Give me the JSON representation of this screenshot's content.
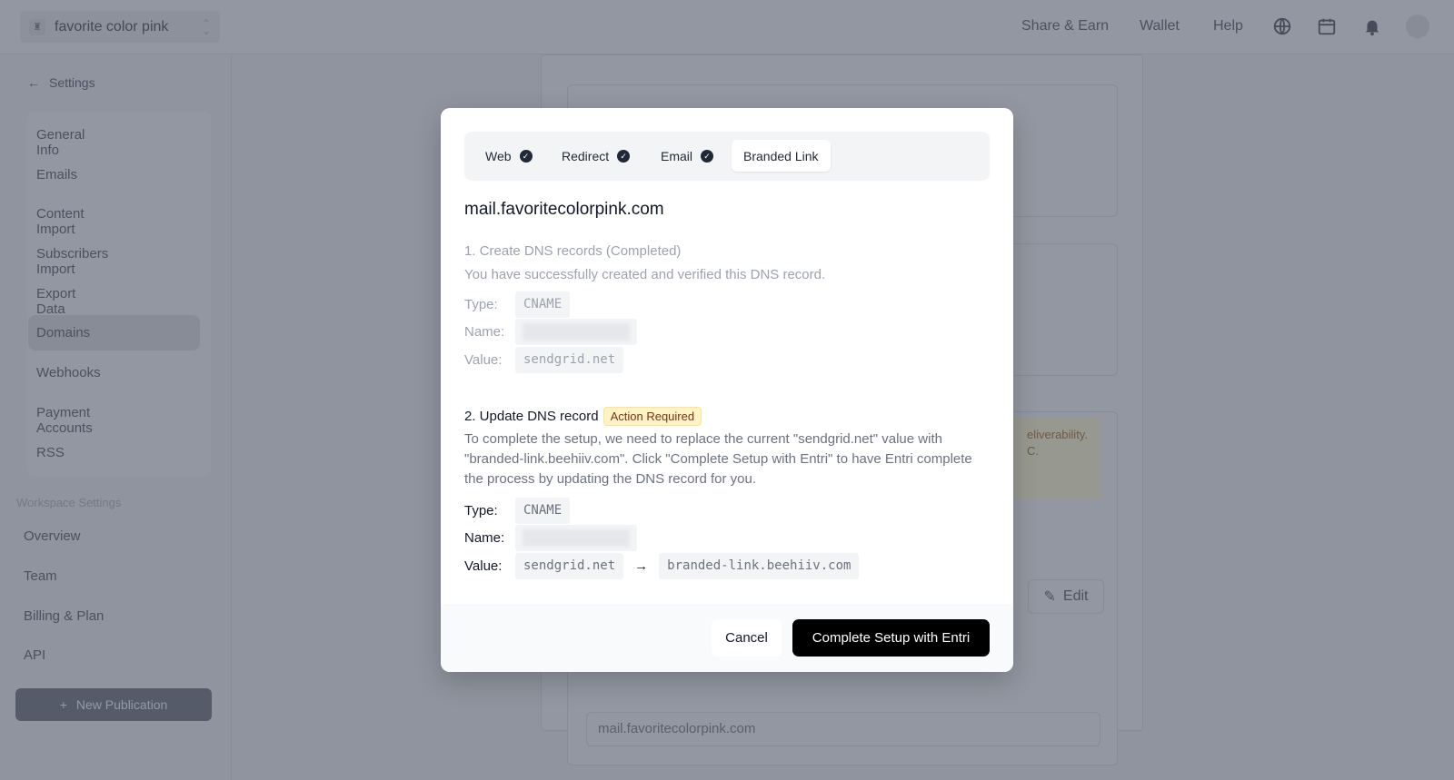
{
  "topbar": {
    "publication": "favorite color pink",
    "links": [
      "Share & Earn",
      "Wallet",
      "Help"
    ]
  },
  "sidebar": {
    "back": "Settings",
    "items": [
      "General Info",
      "Emails",
      "Content Import",
      "Subscribers Import",
      "Export Data",
      "Domains",
      "Webhooks",
      "Payment Accounts",
      "RSS"
    ],
    "active": "Domains",
    "workspace_label": "Workspace Settings",
    "workspace_items": [
      "Overview",
      "Team",
      "Billing & Plan",
      "API"
    ],
    "new_publication": "New Publication"
  },
  "background": {
    "warning_text_1": "eliverability.",
    "warning_text_2": "C.",
    "edit": "Edit",
    "domain_field": "mail.favoritecolorpink.com"
  },
  "modal": {
    "tabs": [
      {
        "label": "Web",
        "done": true
      },
      {
        "label": "Redirect",
        "done": true
      },
      {
        "label": "Email",
        "done": true
      },
      {
        "label": "Branded Link",
        "done": false,
        "active": true
      }
    ],
    "domain": "mail.favoritecolorpink.com",
    "step1": {
      "title": "1. Create DNS records (Completed)",
      "desc": "You have successfully created and verified this DNS record.",
      "type_label": "Type:",
      "type": "CNAME",
      "name_label": "Name:",
      "value_label": "Value:",
      "value": "sendgrid.net"
    },
    "step2": {
      "title": "2. Update DNS record",
      "badge": "Action Required",
      "desc": "To complete the setup, we need to replace the current \"sendgrid.net\" value with \"branded-link.beehiiv.com\". Click \"Complete Setup with Entri\" to have Entri complete the process by updating the DNS record for you.",
      "type_label": "Type:",
      "type": "CNAME",
      "name_label": "Name:",
      "value_label": "Value:",
      "old_value": "sendgrid.net",
      "new_value": "branded-link.beehiiv.com"
    },
    "cancel": "Cancel",
    "confirm": "Complete Setup with Entri"
  },
  "colors": {
    "badge_bg": "#fef3c7",
    "primary": "#000000"
  }
}
